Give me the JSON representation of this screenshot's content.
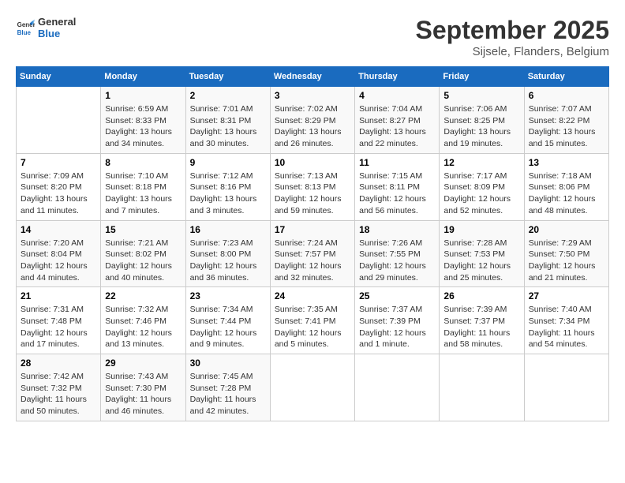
{
  "logo": {
    "text_general": "General",
    "text_blue": "Blue"
  },
  "title": "September 2025",
  "location": "Sijsele, Flanders, Belgium",
  "days_of_week": [
    "Sunday",
    "Monday",
    "Tuesday",
    "Wednesday",
    "Thursday",
    "Friday",
    "Saturday"
  ],
  "weeks": [
    [
      null,
      {
        "num": "1",
        "sunrise": "6:59 AM",
        "sunset": "8:33 PM",
        "daylight": "13 hours and 34 minutes."
      },
      {
        "num": "2",
        "sunrise": "7:01 AM",
        "sunset": "8:31 PM",
        "daylight": "13 hours and 30 minutes."
      },
      {
        "num": "3",
        "sunrise": "7:02 AM",
        "sunset": "8:29 PM",
        "daylight": "13 hours and 26 minutes."
      },
      {
        "num": "4",
        "sunrise": "7:04 AM",
        "sunset": "8:27 PM",
        "daylight": "13 hours and 22 minutes."
      },
      {
        "num": "5",
        "sunrise": "7:06 AM",
        "sunset": "8:25 PM",
        "daylight": "13 hours and 19 minutes."
      },
      {
        "num": "6",
        "sunrise": "7:07 AM",
        "sunset": "8:22 PM",
        "daylight": "13 hours and 15 minutes."
      }
    ],
    [
      {
        "num": "7",
        "sunrise": "7:09 AM",
        "sunset": "8:20 PM",
        "daylight": "13 hours and 11 minutes."
      },
      {
        "num": "8",
        "sunrise": "7:10 AM",
        "sunset": "8:18 PM",
        "daylight": "13 hours and 7 minutes."
      },
      {
        "num": "9",
        "sunrise": "7:12 AM",
        "sunset": "8:16 PM",
        "daylight": "13 hours and 3 minutes."
      },
      {
        "num": "10",
        "sunrise": "7:13 AM",
        "sunset": "8:13 PM",
        "daylight": "12 hours and 59 minutes."
      },
      {
        "num": "11",
        "sunrise": "7:15 AM",
        "sunset": "8:11 PM",
        "daylight": "12 hours and 56 minutes."
      },
      {
        "num": "12",
        "sunrise": "7:17 AM",
        "sunset": "8:09 PM",
        "daylight": "12 hours and 52 minutes."
      },
      {
        "num": "13",
        "sunrise": "7:18 AM",
        "sunset": "8:06 PM",
        "daylight": "12 hours and 48 minutes."
      }
    ],
    [
      {
        "num": "14",
        "sunrise": "7:20 AM",
        "sunset": "8:04 PM",
        "daylight": "12 hours and 44 minutes."
      },
      {
        "num": "15",
        "sunrise": "7:21 AM",
        "sunset": "8:02 PM",
        "daylight": "12 hours and 40 minutes."
      },
      {
        "num": "16",
        "sunrise": "7:23 AM",
        "sunset": "8:00 PM",
        "daylight": "12 hours and 36 minutes."
      },
      {
        "num": "17",
        "sunrise": "7:24 AM",
        "sunset": "7:57 PM",
        "daylight": "12 hours and 32 minutes."
      },
      {
        "num": "18",
        "sunrise": "7:26 AM",
        "sunset": "7:55 PM",
        "daylight": "12 hours and 29 minutes."
      },
      {
        "num": "19",
        "sunrise": "7:28 AM",
        "sunset": "7:53 PM",
        "daylight": "12 hours and 25 minutes."
      },
      {
        "num": "20",
        "sunrise": "7:29 AM",
        "sunset": "7:50 PM",
        "daylight": "12 hours and 21 minutes."
      }
    ],
    [
      {
        "num": "21",
        "sunrise": "7:31 AM",
        "sunset": "7:48 PM",
        "daylight": "12 hours and 17 minutes."
      },
      {
        "num": "22",
        "sunrise": "7:32 AM",
        "sunset": "7:46 PM",
        "daylight": "12 hours and 13 minutes."
      },
      {
        "num": "23",
        "sunrise": "7:34 AM",
        "sunset": "7:44 PM",
        "daylight": "12 hours and 9 minutes."
      },
      {
        "num": "24",
        "sunrise": "7:35 AM",
        "sunset": "7:41 PM",
        "daylight": "12 hours and 5 minutes."
      },
      {
        "num": "25",
        "sunrise": "7:37 AM",
        "sunset": "7:39 PM",
        "daylight": "12 hours and 1 minute."
      },
      {
        "num": "26",
        "sunrise": "7:39 AM",
        "sunset": "7:37 PM",
        "daylight": "11 hours and 58 minutes."
      },
      {
        "num": "27",
        "sunrise": "7:40 AM",
        "sunset": "7:34 PM",
        "daylight": "11 hours and 54 minutes."
      }
    ],
    [
      {
        "num": "28",
        "sunrise": "7:42 AM",
        "sunset": "7:32 PM",
        "daylight": "11 hours and 50 minutes."
      },
      {
        "num": "29",
        "sunrise": "7:43 AM",
        "sunset": "7:30 PM",
        "daylight": "11 hours and 46 minutes."
      },
      {
        "num": "30",
        "sunrise": "7:45 AM",
        "sunset": "7:28 PM",
        "daylight": "11 hours and 42 minutes."
      },
      null,
      null,
      null,
      null
    ]
  ]
}
